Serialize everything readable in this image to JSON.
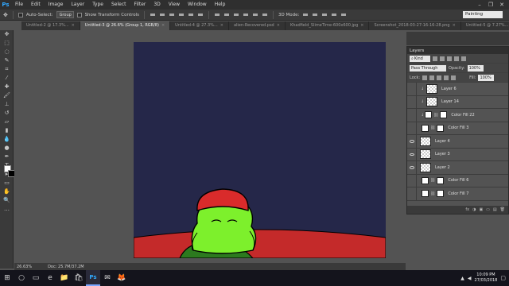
{
  "app": {
    "logo": "Ps"
  },
  "menu": [
    "File",
    "Edit",
    "Image",
    "Layer",
    "Type",
    "Select",
    "Filter",
    "3D",
    "View",
    "Window",
    "Help"
  ],
  "window_controls": [
    "–",
    "❐",
    "✕"
  ],
  "options_bar": {
    "auto_select_label": "Auto-Select:",
    "auto_select_value": "Group",
    "transform_label": "Show Transform Controls",
    "mode_label": "3D Mode:",
    "workspace": "Painting"
  },
  "tabs": [
    {
      "label": "Untitled-2 @ 17.3%...",
      "active": false
    },
    {
      "label": "Untitled-3 @ 26.6% (Group 1, RGB/8)",
      "active": true
    },
    {
      "label": "Untitled-4 @ 27.3%...",
      "active": false
    },
    {
      "label": "alien-Recovered.psd",
      "active": false
    },
    {
      "label": "Khadfield_SlimeTime-600x600.jpg",
      "active": false
    },
    {
      "label": "Screenshot_2018-03-27-16-16-28.png",
      "active": false
    },
    {
      "label": "Untitled-5 @ 7.27%...",
      "active": false
    }
  ],
  "layers_panel": {
    "title": "Layers",
    "kind_label": "Kind",
    "blend_mode": "Pass Through",
    "opacity_label": "Opacity:",
    "opacity_value": "100%",
    "lock_label": "Lock:",
    "fill_label": "Fill:",
    "fill_value": "100%",
    "layers": [
      {
        "name": "Layer 6",
        "visible": false,
        "type": "pixel",
        "clipped": true
      },
      {
        "name": "Layer 14",
        "visible": false,
        "type": "pixel",
        "clipped": true
      },
      {
        "name": "Color Fill 22",
        "visible": false,
        "type": "fill",
        "clipped": true
      },
      {
        "name": "Color Fill 3",
        "visible": false,
        "type": "fill",
        "clipped": false
      },
      {
        "name": "Layer 4",
        "visible": true,
        "type": "pixel",
        "clipped": false
      },
      {
        "name": "Layer 3",
        "visible": true,
        "type": "pixel",
        "clipped": false
      },
      {
        "name": "Layer 2",
        "visible": true,
        "type": "pixel",
        "clipped": false
      },
      {
        "name": "Color Fill 6",
        "visible": false,
        "type": "fill",
        "clipped": false
      },
      {
        "name": "Color Fill 7",
        "visible": false,
        "type": "fill",
        "clipped": false
      }
    ],
    "footer_icons": [
      "fx",
      "◑",
      "▣",
      "▭",
      "▤",
      "🗑"
    ]
  },
  "status_bar": {
    "zoom": "26.63%",
    "doc": "Doc: 25.7M/37.2M"
  },
  "taskbar": {
    "icons": [
      "⊞",
      "○",
      "▭",
      "e",
      "📁",
      "🛍",
      "Ps",
      "✉",
      "🦊"
    ],
    "time": "10:09 PM",
    "date": "27/03/2018"
  },
  "colors": {
    "canvas_bg": "#252749",
    "ground": "#c42a2a",
    "slime": "#7df02c",
    "hat": "#d92b2b"
  }
}
